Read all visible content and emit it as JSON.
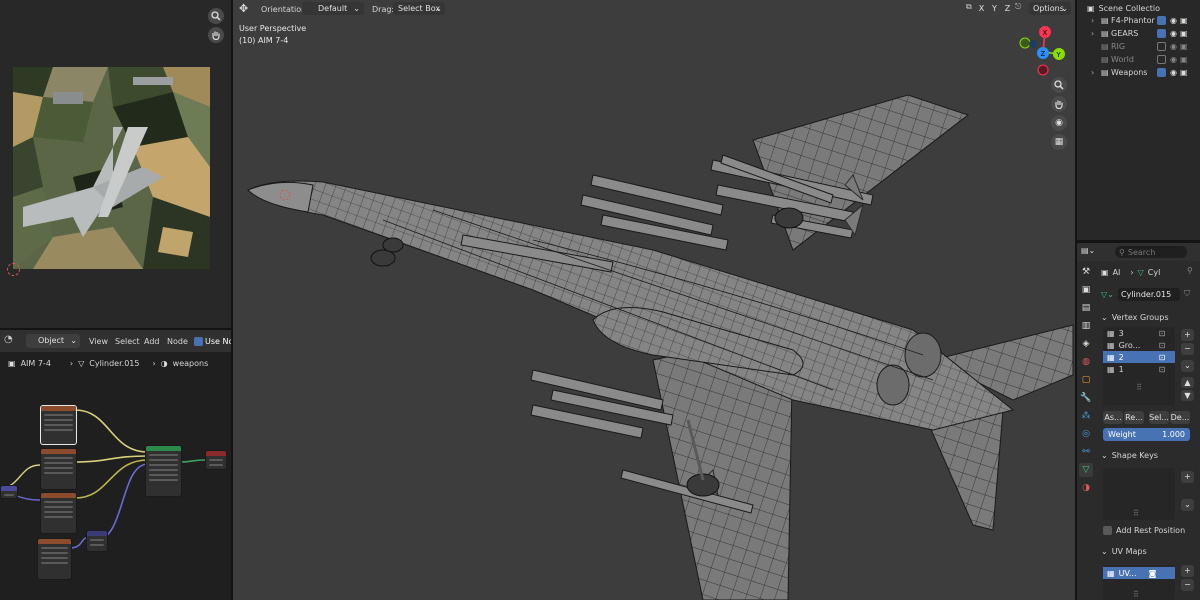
{
  "image_editor": {
    "zoom_icon": "zoom-icon",
    "pan_icon": "hand-icon"
  },
  "node_editor": {
    "object_label": "Object",
    "menus": [
      "View",
      "Select",
      "Add",
      "Node"
    ],
    "use_nodes_label": "Use Nod",
    "breadcrumb": {
      "object": "AIM 7-4",
      "mesh": "Cylinder.015",
      "material": "weapons"
    }
  },
  "viewport": {
    "orientation_label": "Orientation:",
    "orientation_value": "Default",
    "drag_label": "Drag:",
    "drag_value": "Select Box",
    "axes": [
      "X",
      "Y",
      "Z"
    ],
    "options_label": "Options",
    "view_name": "User Perspective",
    "object_info": "(10) AIM 7-4",
    "gizmo_labels": [
      "X",
      "Y",
      "Z"
    ],
    "colors": {
      "x": "#ff3352",
      "y": "#8bdc00",
      "z": "#2890ff"
    }
  },
  "outliner": {
    "root": "Scene Collectio",
    "items": [
      {
        "label": "F4-Phantor",
        "enabled": true
      },
      {
        "label": "GEARS",
        "enabled": true
      },
      {
        "label": "RIG",
        "enabled": false
      },
      {
        "label": "World",
        "enabled": false
      },
      {
        "label": "Weapons",
        "enabled": true
      }
    ]
  },
  "properties": {
    "search_placeholder": "Search",
    "breadcrumb_a": "AI",
    "breadcrumb_b": "Cyl",
    "mesh_name": "Cylinder.015",
    "vertex_groups_title": "Vertex Groups",
    "vertex_groups": [
      "3",
      "Gro...",
      "2",
      "1"
    ],
    "selected_group": "2",
    "buttons": [
      "As...",
      "Re...",
      "Sel...",
      "De..."
    ],
    "weight_label": "Weight",
    "weight_value": "1.000",
    "shape_keys_title": "Shape Keys",
    "add_rest_label": "Add Rest Position",
    "uv_maps_title": "UV Maps",
    "uv_map": "UV..."
  }
}
